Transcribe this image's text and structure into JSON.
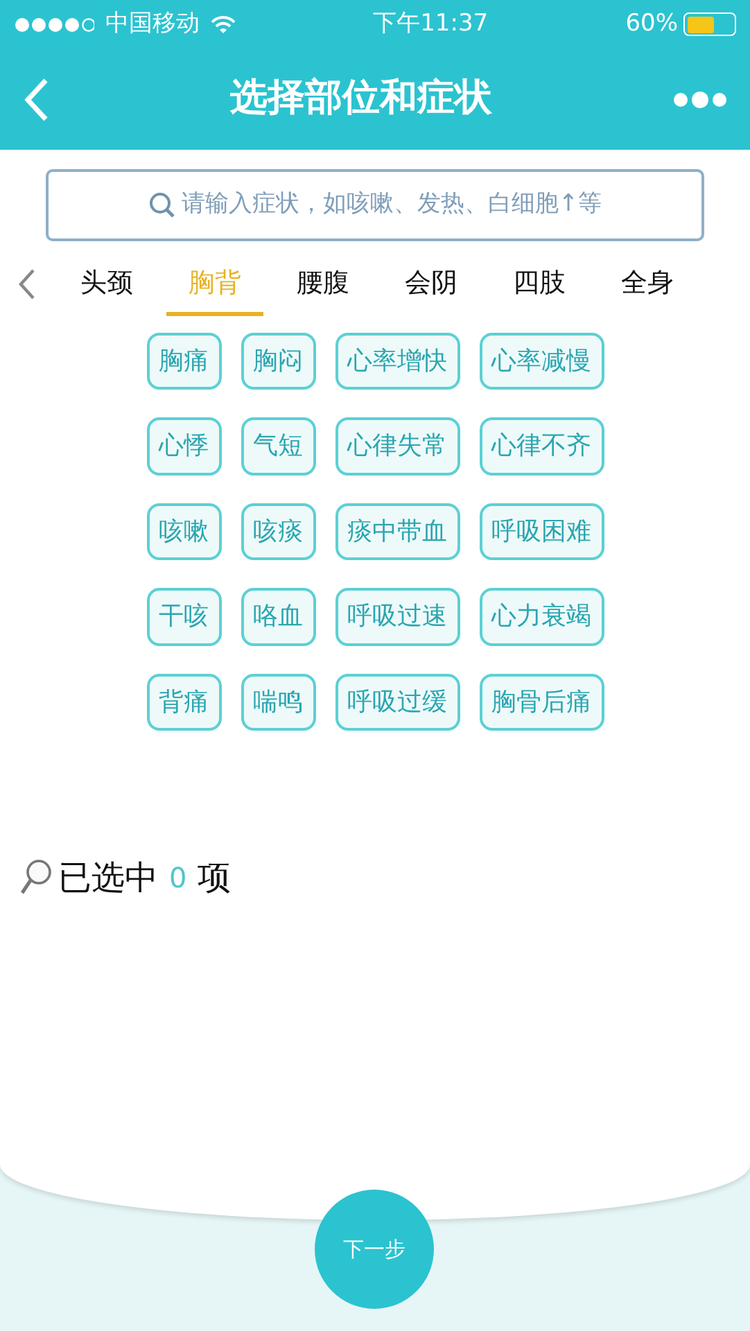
{
  "status_bar": {
    "carrier": "中国移动",
    "time": "下午11:37",
    "battery": "60%"
  },
  "header": {
    "title": "选择部位和症状"
  },
  "search": {
    "placeholder": "请输入症状，如咳嗽、发热、白细胞↑等"
  },
  "tabs": [
    {
      "label": "头颈",
      "selected": false
    },
    {
      "label": "胸背",
      "selected": true
    },
    {
      "label": "腰腹",
      "selected": false
    },
    {
      "label": "会阴",
      "selected": false
    },
    {
      "label": "四肢",
      "selected": false
    },
    {
      "label": "全身",
      "selected": false
    }
  ],
  "symptoms": [
    {
      "label": "胸痛",
      "selected": false
    },
    {
      "label": "胸闷",
      "selected": false
    },
    {
      "label": "心率增快",
      "selected": false
    },
    {
      "label": "心率减慢",
      "selected": false
    },
    {
      "label": "心悸",
      "selected": false
    },
    {
      "label": "气短",
      "selected": false
    },
    {
      "label": "心律失常",
      "selected": false
    },
    {
      "label": "心律不齐",
      "selected": false
    },
    {
      "label": "咳嗽",
      "selected": false
    },
    {
      "label": "咳痰",
      "selected": false
    },
    {
      "label": "痰中带血",
      "selected": false
    },
    {
      "label": "呼吸困难",
      "selected": false
    },
    {
      "label": "干咳",
      "selected": false
    },
    {
      "label": "咯血",
      "selected": false
    },
    {
      "label": "呼吸过速",
      "selected": false
    },
    {
      "label": "心力衰竭",
      "selected": false
    },
    {
      "label": "背痛",
      "selected": false
    },
    {
      "label": "喘鸣",
      "selected": false
    },
    {
      "label": "呼吸过缓",
      "selected": false
    },
    {
      "label": "胸骨后痛",
      "selected": false
    }
  ],
  "selection": {
    "prefix": "已选中",
    "count": "0",
    "suffix": "项"
  },
  "next_button": {
    "label": "下一步"
  }
}
